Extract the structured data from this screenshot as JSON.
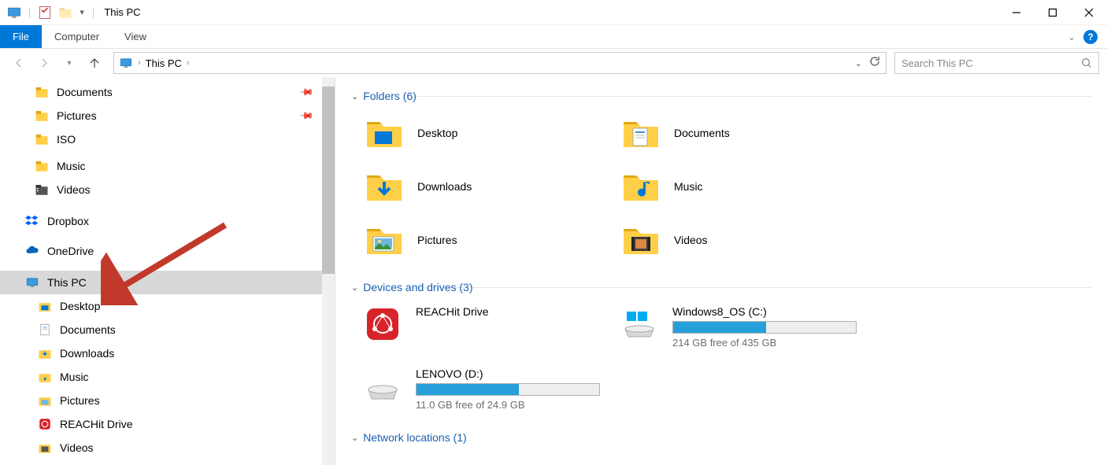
{
  "titlebar": {
    "title": "This PC"
  },
  "ribbon": {
    "file": "File",
    "computer": "Computer",
    "view": "View"
  },
  "nav": {
    "breadcrumb": "This PC",
    "search_placeholder": "Search This PC"
  },
  "sidebar": {
    "quick": [
      {
        "label": "Documents",
        "pinned": true
      },
      {
        "label": "Pictures",
        "pinned": true
      },
      {
        "label": "ISO",
        "pinned": false
      },
      {
        "label": "Music",
        "pinned": false
      },
      {
        "label": "Videos",
        "pinned": false
      }
    ],
    "cloud": [
      {
        "label": "Dropbox"
      },
      {
        "label": "OneDrive"
      }
    ],
    "this_pc": "This PC",
    "this_pc_children": [
      {
        "label": "Desktop"
      },
      {
        "label": "Documents"
      },
      {
        "label": "Downloads"
      },
      {
        "label": "Music"
      },
      {
        "label": "Pictures"
      },
      {
        "label": "REACHit Drive"
      },
      {
        "label": "Videos"
      }
    ]
  },
  "content": {
    "folders_head": "Folders (6)",
    "folders": [
      {
        "label": "Desktop"
      },
      {
        "label": "Documents"
      },
      {
        "label": "Downloads"
      },
      {
        "label": "Music"
      },
      {
        "label": "Pictures"
      },
      {
        "label": "Videos"
      }
    ],
    "drives_head": "Devices and drives (3)",
    "drives": [
      {
        "label": "REACHit Drive",
        "bar": false
      },
      {
        "label": "Windows8_OS (C:)",
        "bar": true,
        "fill_pct": 51,
        "free": "214 GB free of 435 GB"
      },
      {
        "label": "LENOVO (D:)",
        "bar": true,
        "fill_pct": 56,
        "free": "11.0 GB free of 24.9 GB"
      }
    ],
    "network_head": "Network locations (1)"
  }
}
